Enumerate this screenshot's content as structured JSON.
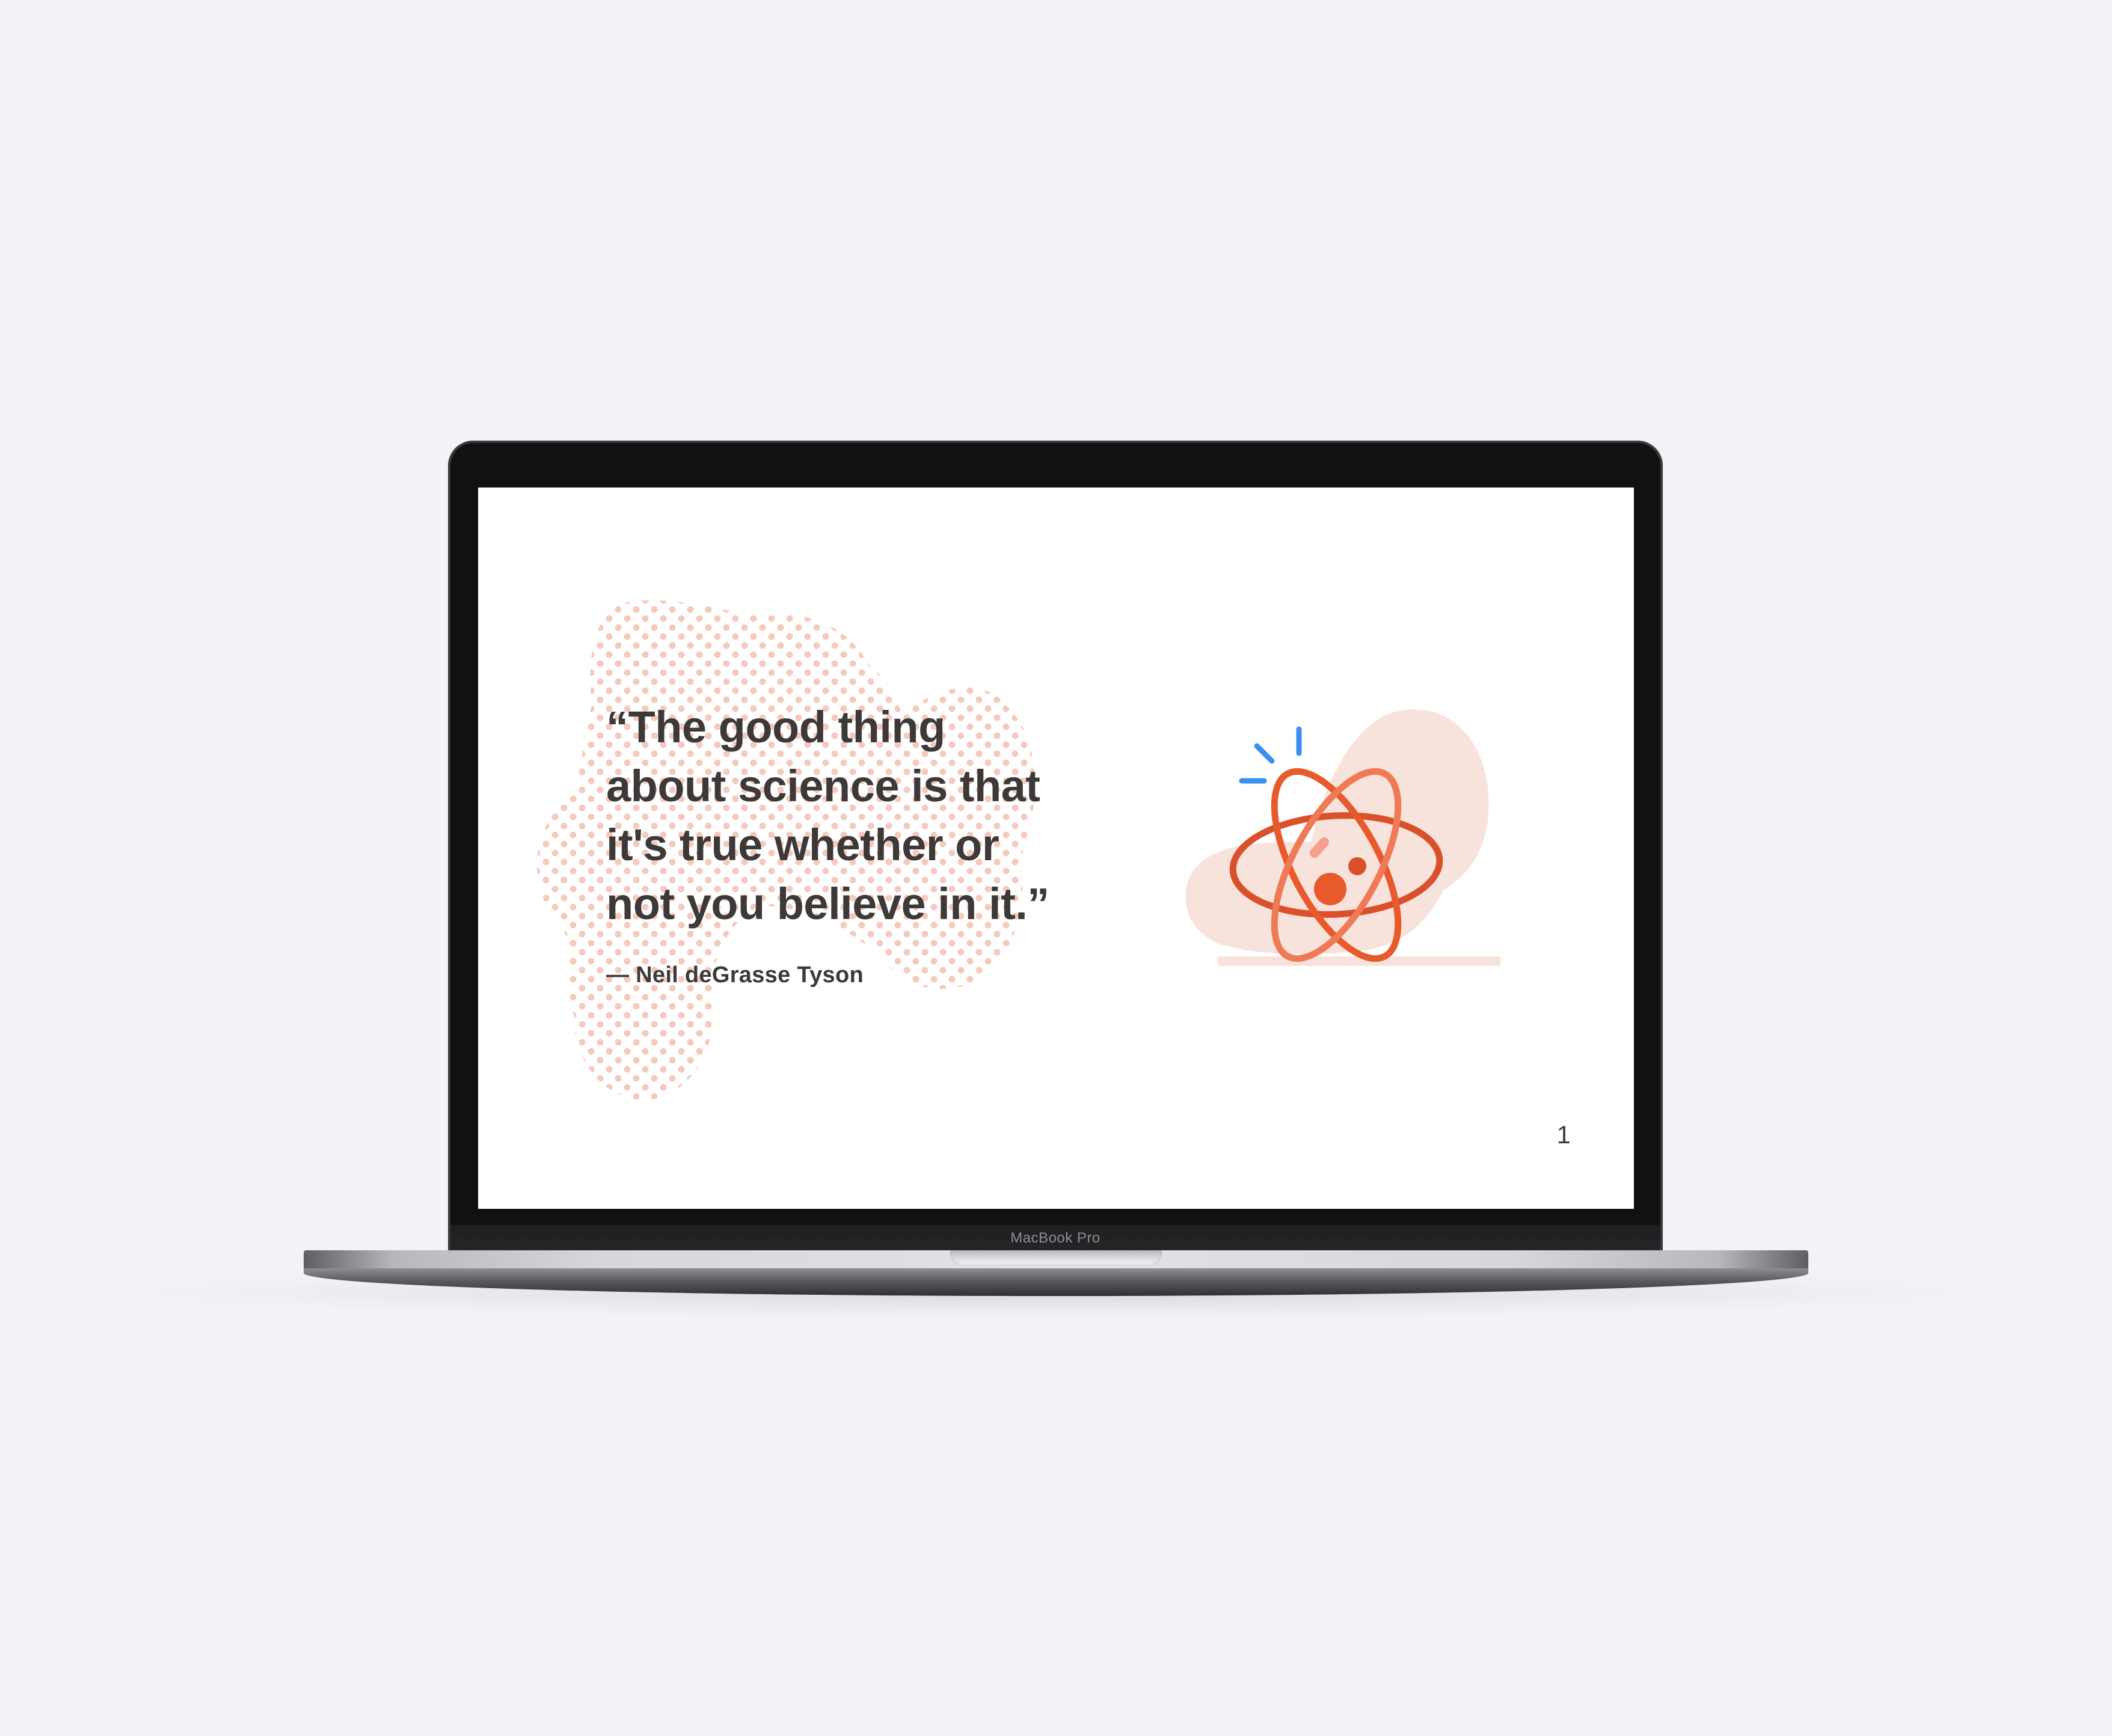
{
  "device": {
    "brand_label": "MacBook Pro"
  },
  "slide": {
    "quote": "“The good thing\nabout science is that\nit's true whether or\nnot you believe in it.”",
    "author": "— Neil deGrasse Tyson",
    "page_number": "1"
  },
  "illustration": {
    "icon": "atom-icon",
    "accent_color": "#e85a2c",
    "spark_color": "#3b8ff0",
    "blob_color": "#f7e3dc"
  },
  "colors": {
    "background": "#f2f3f7",
    "text": "#3d3938",
    "dot_pattern": "#f6c9bb"
  }
}
